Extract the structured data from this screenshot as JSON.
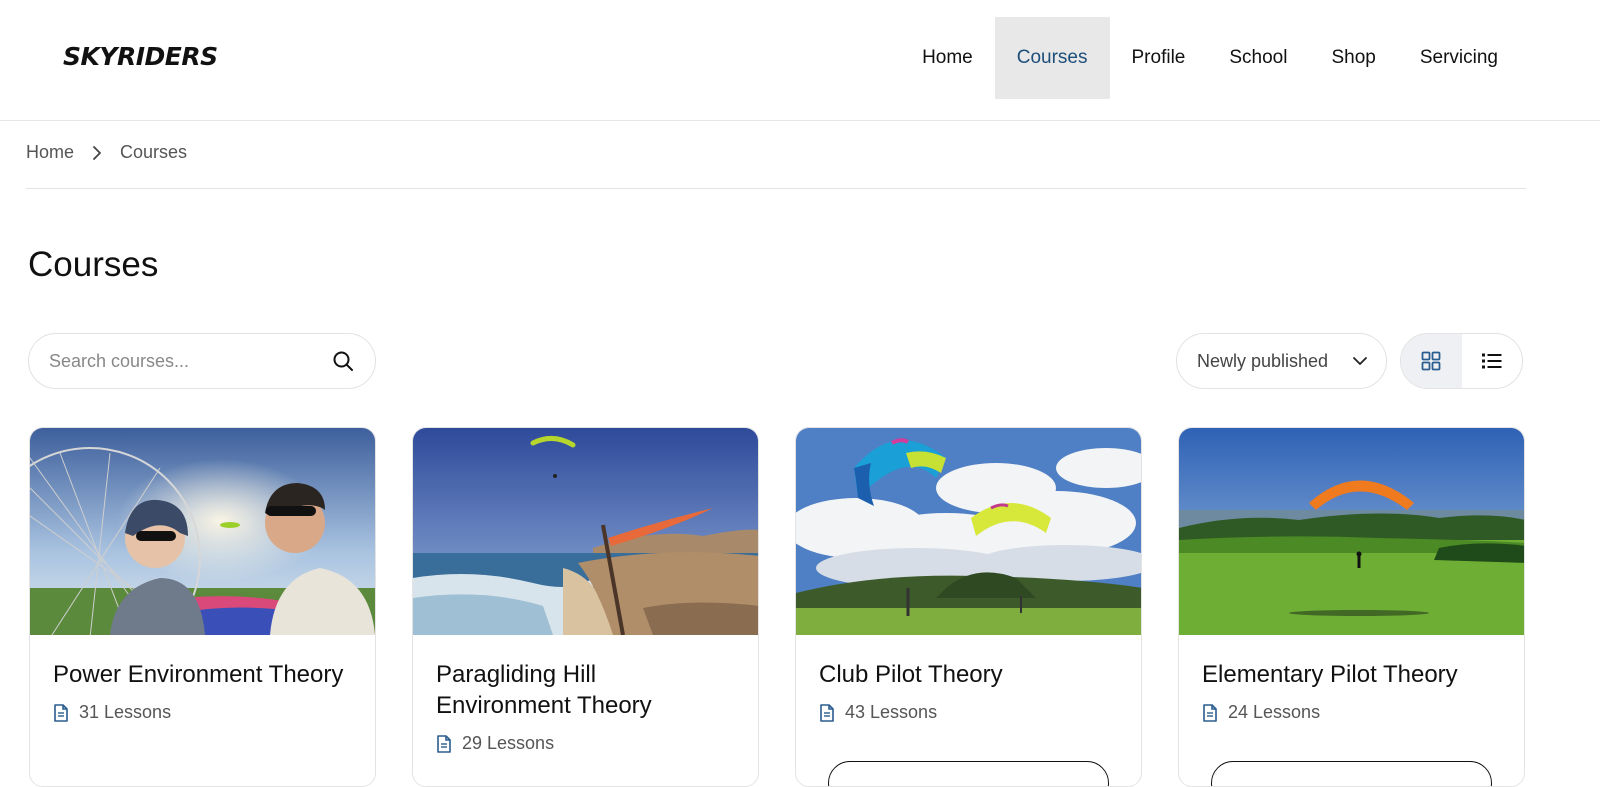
{
  "header": {
    "logo": "SKYRIDERS",
    "nav": [
      {
        "label": "Home",
        "active": false
      },
      {
        "label": "Courses",
        "active": true
      },
      {
        "label": "Profile",
        "active": false
      },
      {
        "label": "School",
        "active": false
      },
      {
        "label": "Shop",
        "active": false
      },
      {
        "label": "Servicing",
        "active": false
      }
    ]
  },
  "breadcrumb": {
    "home": "Home",
    "current": "Courses"
  },
  "page": {
    "title": "Courses"
  },
  "search": {
    "placeholder": "Search courses...",
    "value": ""
  },
  "sort": {
    "selected": "Newly published"
  },
  "view": {
    "active": "grid",
    "options": [
      "grid",
      "list"
    ]
  },
  "courses": [
    {
      "title": "Power Environment Theory",
      "lessons": "31 Lessons"
    },
    {
      "title": "Paragliding Hill Environment Theory",
      "lessons": "29 Lessons"
    },
    {
      "title": "Club Pilot Theory",
      "lessons": "43 Lessons"
    },
    {
      "title": "Elementary Pilot Theory",
      "lessons": "24 Lessons"
    }
  ],
  "colors": {
    "accent": "#1d4e7a",
    "nav_active_bg": "#e8e8e8",
    "border": "#e3e3e3"
  },
  "icons": {
    "search": "search-icon",
    "chevron": "chevron-down-icon",
    "breadcrumb_sep": "chevron-right-icon",
    "grid": "grid-view-icon",
    "list": "list-view-icon",
    "lessons": "document-icon"
  }
}
